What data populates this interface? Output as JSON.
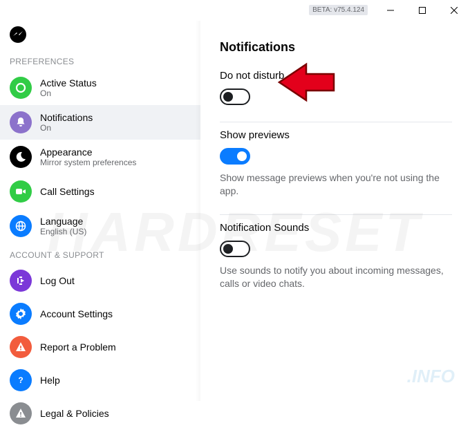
{
  "titlebar": {
    "beta": "BETA: v75.4.124"
  },
  "sidebar": {
    "section1": "PREFERENCES",
    "section2": "ACCOUNT & SUPPORT",
    "items": [
      {
        "label": "Active Status",
        "sub": "On"
      },
      {
        "label": "Notifications",
        "sub": "On"
      },
      {
        "label": "Appearance",
        "sub": "Mirror system preferences"
      },
      {
        "label": "Call Settings",
        "sub": ""
      },
      {
        "label": "Language",
        "sub": "English (US)"
      },
      {
        "label": "Log Out"
      },
      {
        "label": "Account Settings"
      },
      {
        "label": "Report a Problem"
      },
      {
        "label": "Help"
      },
      {
        "label": "Legal & Policies"
      }
    ]
  },
  "main": {
    "title": "Notifications",
    "dnd": {
      "title": "Do not disturb",
      "on": false
    },
    "previews": {
      "title": "Show previews",
      "desc": "Show message previews when you're not using the app.",
      "on": true
    },
    "sounds": {
      "title": "Notification Sounds",
      "desc": "Use sounds to notify you about incoming messages, calls or video chats.",
      "on": false
    }
  },
  "watermark": {
    "big": "HARDRESET",
    "small": ".INFO"
  }
}
